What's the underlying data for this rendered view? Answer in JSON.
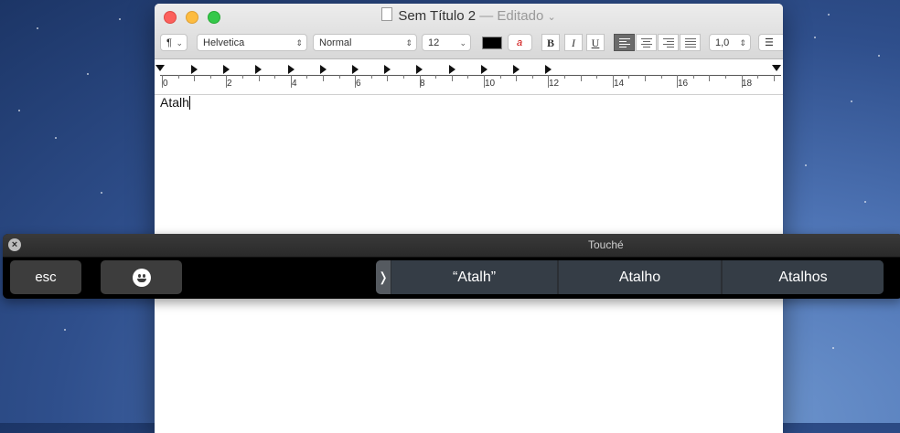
{
  "window": {
    "title": "Sem Título 2",
    "edited_label": "— Editado",
    "dropdown_chevron": "⌄"
  },
  "toolbar": {
    "paragraph_style": "¶",
    "font_family": "Helvetica",
    "font_style": "Normal",
    "font_size": "12",
    "bold": "B",
    "italic": "I",
    "underline": "U",
    "line_spacing": "1,0",
    "text_color": "#000000",
    "highlight_glyph": "a"
  },
  "ruler": {
    "labels": [
      "0",
      "2",
      "4",
      "6",
      "8",
      "10",
      "12",
      "14",
      "16",
      "18"
    ]
  },
  "document": {
    "text": "Atalh"
  },
  "touche": {
    "title": "Touché",
    "esc_label": "esc",
    "expand_glyph": "❭",
    "suggestions": [
      "“Atalh”",
      "Atalho",
      "Atalhos"
    ]
  }
}
